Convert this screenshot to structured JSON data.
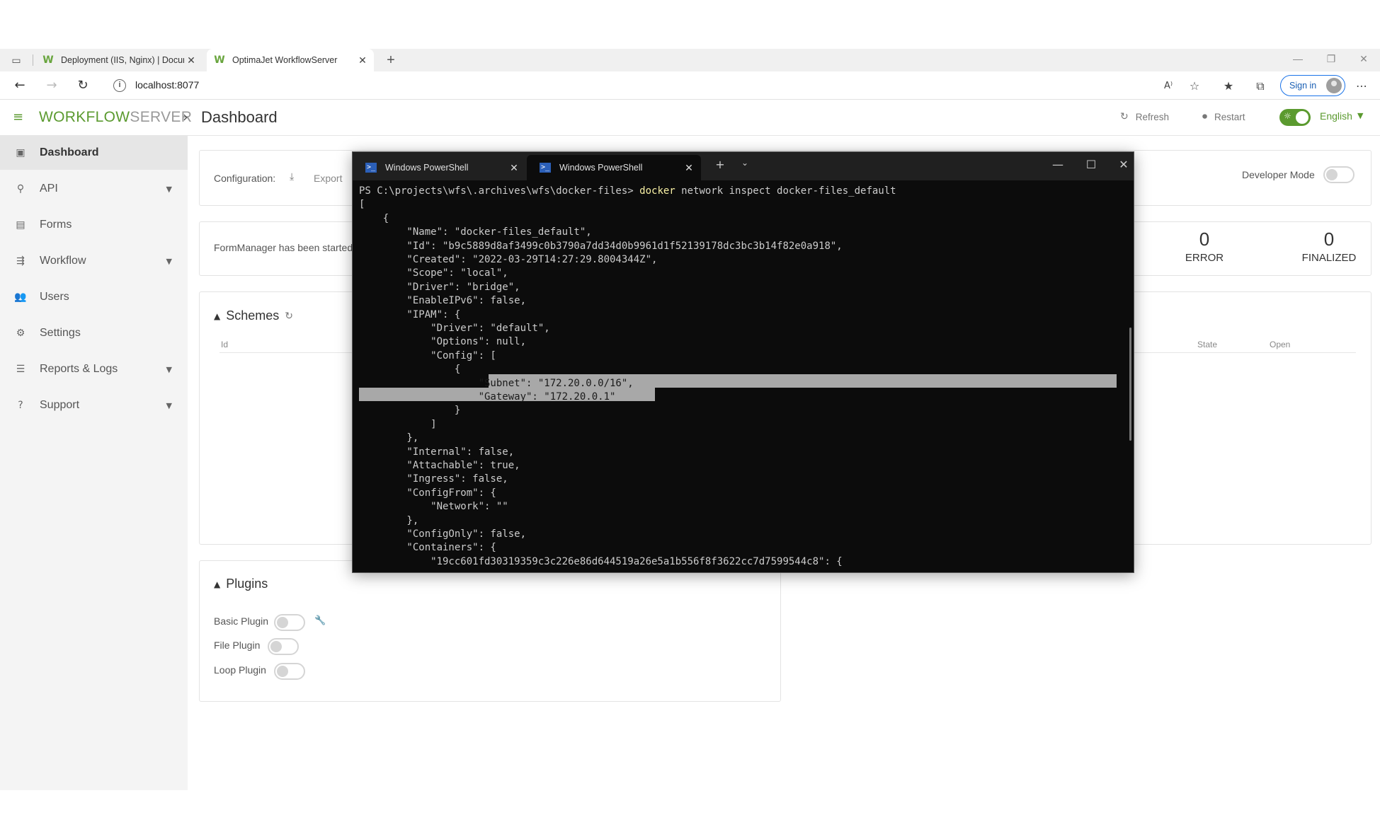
{
  "browser": {
    "tabs": [
      {
        "title": "Deployment (IIS, Nginx) | Docum",
        "active": false
      },
      {
        "title": "OptimaJet WorkflowServer",
        "active": true
      }
    ],
    "new_tab": "+",
    "url": "localhost:8077",
    "sign_in": "Sign in"
  },
  "app": {
    "logo_part1": "WORKFLOW",
    "logo_part2": "SERVER",
    "page_title": "Dashboard",
    "refresh_label": "Refresh",
    "restart_label": "Restart",
    "language": "English",
    "accent_color": "#5b9a2f"
  },
  "sidebar": {
    "items": [
      {
        "label": "Dashboard",
        "icon": "dashboard-icon",
        "active": true,
        "expandable": false
      },
      {
        "label": "API",
        "icon": "api-icon",
        "active": false,
        "expandable": true
      },
      {
        "label": "Forms",
        "icon": "forms-icon",
        "active": false,
        "expandable": false
      },
      {
        "label": "Workflow",
        "icon": "workflow-icon",
        "active": false,
        "expandable": true
      },
      {
        "label": "Users",
        "icon": "users-icon",
        "active": false,
        "expandable": false
      },
      {
        "label": "Settings",
        "icon": "settings-icon",
        "active": false,
        "expandable": false
      },
      {
        "label": "Reports & Logs",
        "icon": "reports-icon",
        "active": false,
        "expandable": true
      },
      {
        "label": "Support",
        "icon": "support-icon",
        "active": false,
        "expandable": true
      }
    ]
  },
  "config": {
    "label": "Configuration:",
    "export_label": "Export",
    "developer_mode_label": "Developer Mode",
    "developer_mode_on": false
  },
  "status": {
    "message": "FormManager has been started",
    "error_count": "0",
    "error_label": "ERROR",
    "finalized_count": "0",
    "finalized_label": "FINALIZED"
  },
  "schemes": {
    "title": "Schemes",
    "columns": [
      "Id",
      "State",
      "Open"
    ]
  },
  "plugins": {
    "title": "Plugins",
    "items": [
      {
        "label": "Basic Plugin",
        "enabled": false,
        "has_settings": true
      },
      {
        "label": "File Plugin",
        "enabled": false,
        "has_settings": false
      },
      {
        "label": "Loop Plugin",
        "enabled": false,
        "has_settings": false
      }
    ]
  },
  "powershell": {
    "tabs": [
      {
        "title": "Windows PowerShell",
        "active": false
      },
      {
        "title": "Windows PowerShell",
        "active": true
      }
    ],
    "prompt": "PS C:\\projects\\wfs\\.archives\\wfs\\docker-files> ",
    "command": "docker",
    "command_args": " network inspect docker-files_default",
    "output_lines": [
      "[",
      "    {",
      "        \"Name\": \"docker-files_default\",",
      "        \"Id\": \"b9c5889d8af3499c0b3790a7dd34d0b9961d1f52139178dc3bc3b14f82e0a918\",",
      "        \"Created\": \"2022-03-29T14:27:29.8004344Z\",",
      "        \"Scope\": \"local\",",
      "        \"Driver\": \"bridge\",",
      "        \"EnableIPv6\": false,",
      "        \"IPAM\": {",
      "            \"Driver\": \"default\",",
      "            \"Options\": null,",
      "            \"Config\": [",
      "                {",
      "                    \"Subnet\": \"172.20.0.0/16\",",
      "                    \"Gateway\": \"172.20.0.1\"",
      "                }",
      "            ]",
      "        },",
      "        \"Internal\": false,",
      "        \"Attachable\": true,",
      "        \"Ingress\": false,",
      "        \"ConfigFrom\": {",
      "            \"Network\": \"\"",
      "        },",
      "        \"ConfigOnly\": false,",
      "        \"Containers\": {",
      "            \"19cc601fd30319359c3c226e86d644519a26e5a1b556f8f3622cc7d7599544c8\": {"
    ]
  }
}
